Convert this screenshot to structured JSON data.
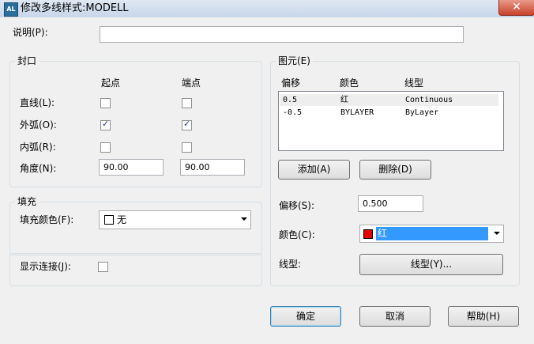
{
  "window": {
    "app_icon_text": "AL",
    "title": "修改多线样式:MODELL",
    "close_glyph": "✕"
  },
  "description": {
    "label": "说明(P):",
    "value": ""
  },
  "caps": {
    "title": "封口",
    "col_start": "起点",
    "col_end": "端点",
    "rows": [
      {
        "label": "直线(L):",
        "start_checked": false,
        "end_checked": false
      },
      {
        "label": "外弧(O):",
        "start_checked": true,
        "end_checked": true
      },
      {
        "label": "内弧(R):",
        "start_checked": false,
        "end_checked": false
      }
    ],
    "angle_label": "角度(N):",
    "angle_start": "90.00",
    "angle_end": "90.00"
  },
  "fill": {
    "title": "填充",
    "color_label": "填充颜色(F):",
    "color_value": "无",
    "swatch_color": "#ffffff"
  },
  "display_joints": {
    "label": "显示连接(J):",
    "checked": false
  },
  "elements": {
    "title": "图元(E)",
    "headers": {
      "offset": "偏移",
      "color": "颜色",
      "linetype": "线型"
    },
    "rows": [
      {
        "offset": "0.5",
        "color": "红",
        "linetype": "Continuous",
        "selected": true
      },
      {
        "offset": "-0.5",
        "color": "BYLAYER",
        "linetype": "ByLayer",
        "selected": false
      }
    ],
    "add_button": "添加(A)",
    "delete_button": "删除(D)",
    "offset_label": "偏移(S):",
    "offset_value": "0.500",
    "color_label": "颜色(C):",
    "color_value": "红",
    "color_swatch": "#e00000",
    "color_highlight": "#3399ff",
    "linetype_label": "线型:",
    "linetype_button": "线型(Y)..."
  },
  "footer": {
    "ok": "确定",
    "cancel": "取消",
    "help": "帮助(H)"
  }
}
